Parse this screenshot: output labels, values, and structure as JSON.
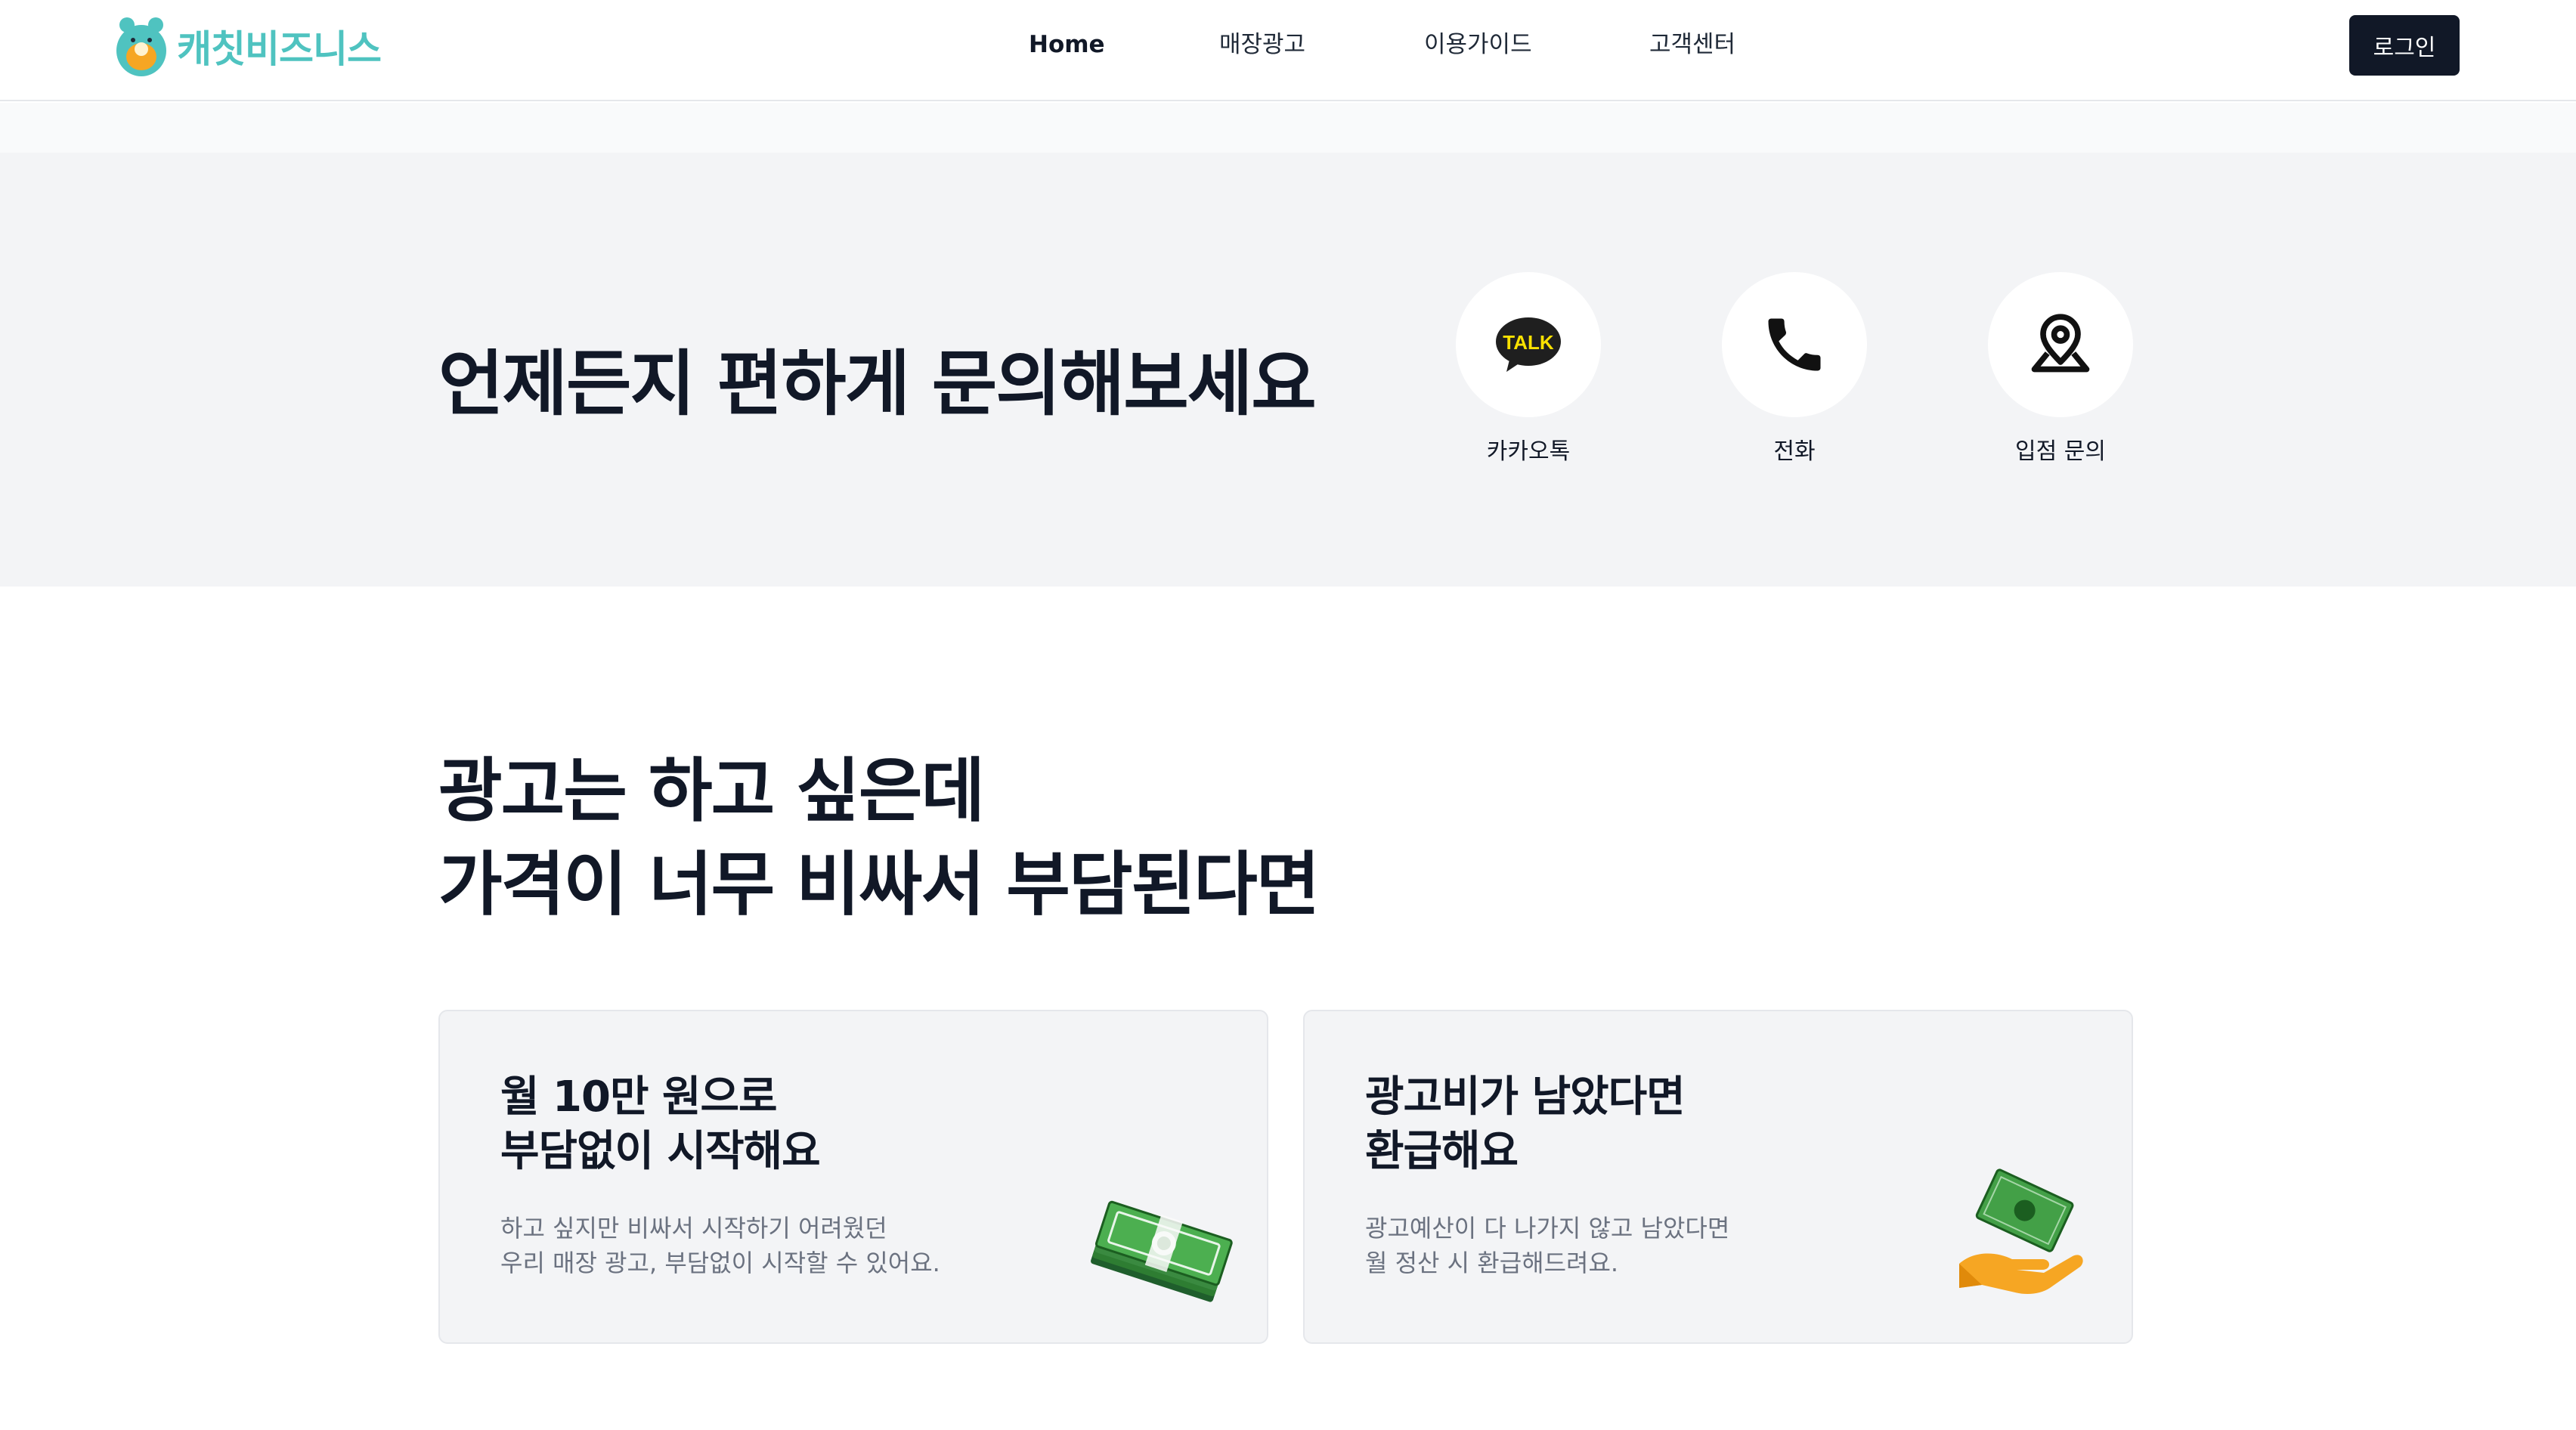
{
  "header": {
    "logo_text": "캐칫비즈니스",
    "nav": [
      "Home",
      "매장광고",
      "이용가이드",
      "고객센터"
    ],
    "login_label": "로그인"
  },
  "contact": {
    "title": "언제든지 편하게 문의해보세요",
    "items": [
      {
        "label": "카카오톡",
        "icon": "kakaotalk-icon",
        "badge": "TALK"
      },
      {
        "label": "전화",
        "icon": "phone-icon"
      },
      {
        "label": "입점 문의",
        "icon": "location-pin-icon"
      }
    ]
  },
  "section": {
    "title_lines": [
      "광고는 하고 싶은데",
      "가격이 너무 비싸서 부담된다면"
    ]
  },
  "cards": [
    {
      "title_lines": [
        "월 10만 원으로",
        "부담없이 시작해요"
      ],
      "desc_lines": [
        "하고 싶지만 비싸서 시작하기 어려웠던",
        "우리 매장 광고, 부담없이 시작할 수 있어요."
      ],
      "image": "money-stack-image"
    },
    {
      "title_lines": [
        "광고비가 남았다면",
        "환급해요"
      ],
      "desc_lines": [
        "광고예산이 다 나가지 않고 남았다면",
        "월 정산 시 환급해드려요."
      ],
      "image": "refund-hand-image"
    }
  ],
  "colors": {
    "brand": "#4fc3c0",
    "dark": "#111827",
    "band": "#f3f4f6",
    "kakao_yellow": "#fae100"
  }
}
